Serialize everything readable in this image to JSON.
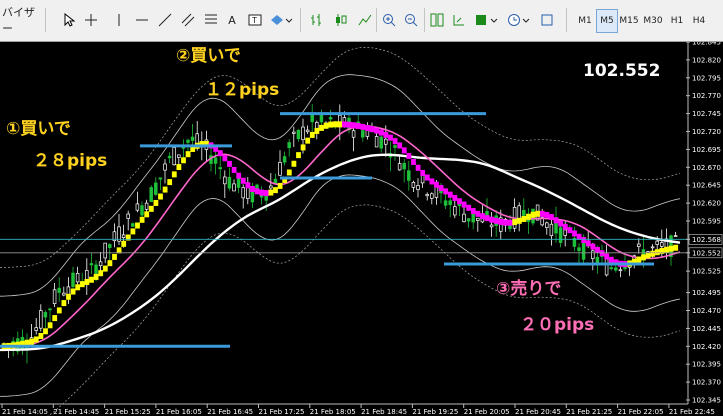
{
  "toolbar": {
    "left_label": "バイザー",
    "timeframes": [
      "M1",
      "M5",
      "M15",
      "M30",
      "H1",
      "H4"
    ],
    "active_timeframe": "M5"
  },
  "chart": {
    "current_price": "102.552",
    "price_axis": [
      "102.845",
      "102.820",
      "102.795",
      "102.770",
      "102.745",
      "102.720",
      "102.695",
      "102.670",
      "102.645",
      "102.620",
      "102.595",
      "102.568",
      "102.552",
      "102.525",
      "102.495",
      "102.470",
      "102.445",
      "102.420",
      "102.395",
      "102.370",
      "102.345"
    ],
    "time_axis": [
      "21 Feb 14:05",
      "21 Feb 14:45",
      "21 Feb 15:25",
      "21 Feb 16:05",
      "21 Feb 16:45",
      "21 Feb 17:25",
      "21 Feb 18:05",
      "21 Feb 18:45",
      "21 Feb 19:25",
      "21 Feb 20:05",
      "21 Feb 20:45",
      "21 Feb 21:25",
      "21 Feb 22:05",
      "21 Feb 22:45"
    ],
    "annotations": [
      {
        "line1": "①買いで",
        "line2": "２８pips"
      },
      {
        "line1": "②買いで",
        "line2": "１２pips"
      },
      {
        "line1": "③売りで",
        "line2": "２０pips"
      }
    ],
    "colors": {
      "buy_text": "#ffd21f",
      "sell_text": "#ff6fb5",
      "level_line": "#3b9ad9",
      "ma_yellow": "#ffff00",
      "ma_magenta": "#ff00ff",
      "ma_pink": "#ff66cc",
      "ma_white": "#ffffff"
    }
  }
}
